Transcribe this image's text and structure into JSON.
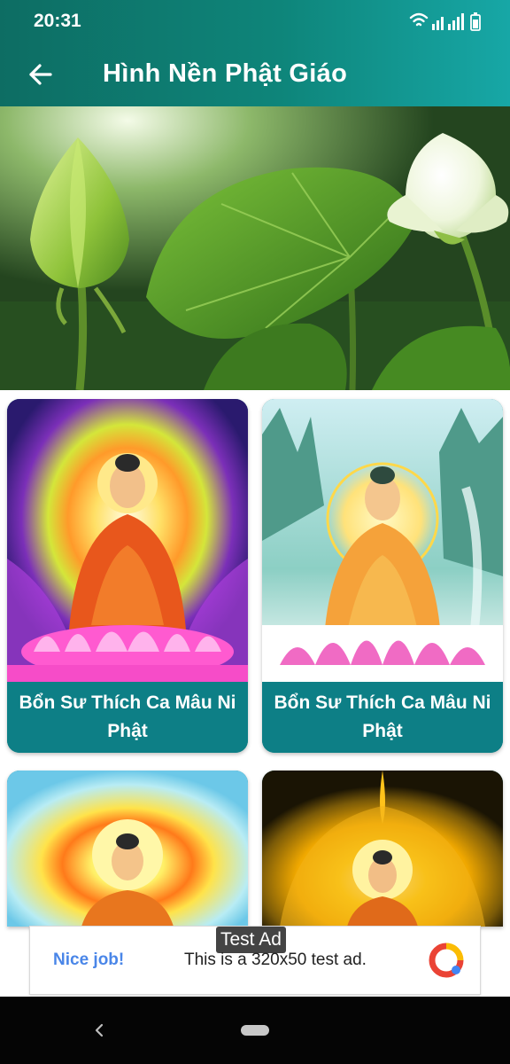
{
  "status_bar": {
    "time": "20:31"
  },
  "app_bar": {
    "title": "Hình Nền Phật Giáo",
    "back_icon": "arrow-left-icon"
  },
  "wallpapers": [
    {
      "title": "Bổn Sư Thích Ca Mâu Ni Phật"
    },
    {
      "title": "Bổn Sư Thích Ca Mâu Ni Phật"
    }
  ],
  "ad": {
    "tag": "Test Ad",
    "headline": "Nice job!",
    "body": "This is a 320x50 test ad.",
    "colors": {
      "headline": "#4a86e8",
      "logo_red": "#ea4335",
      "logo_yellow": "#fbbc04",
      "logo_blue": "#4285f4"
    }
  },
  "colors": {
    "app_bar_start": "#0d6d63",
    "app_bar_end": "#17a7a6",
    "caption_bg": "#0d7f86"
  }
}
